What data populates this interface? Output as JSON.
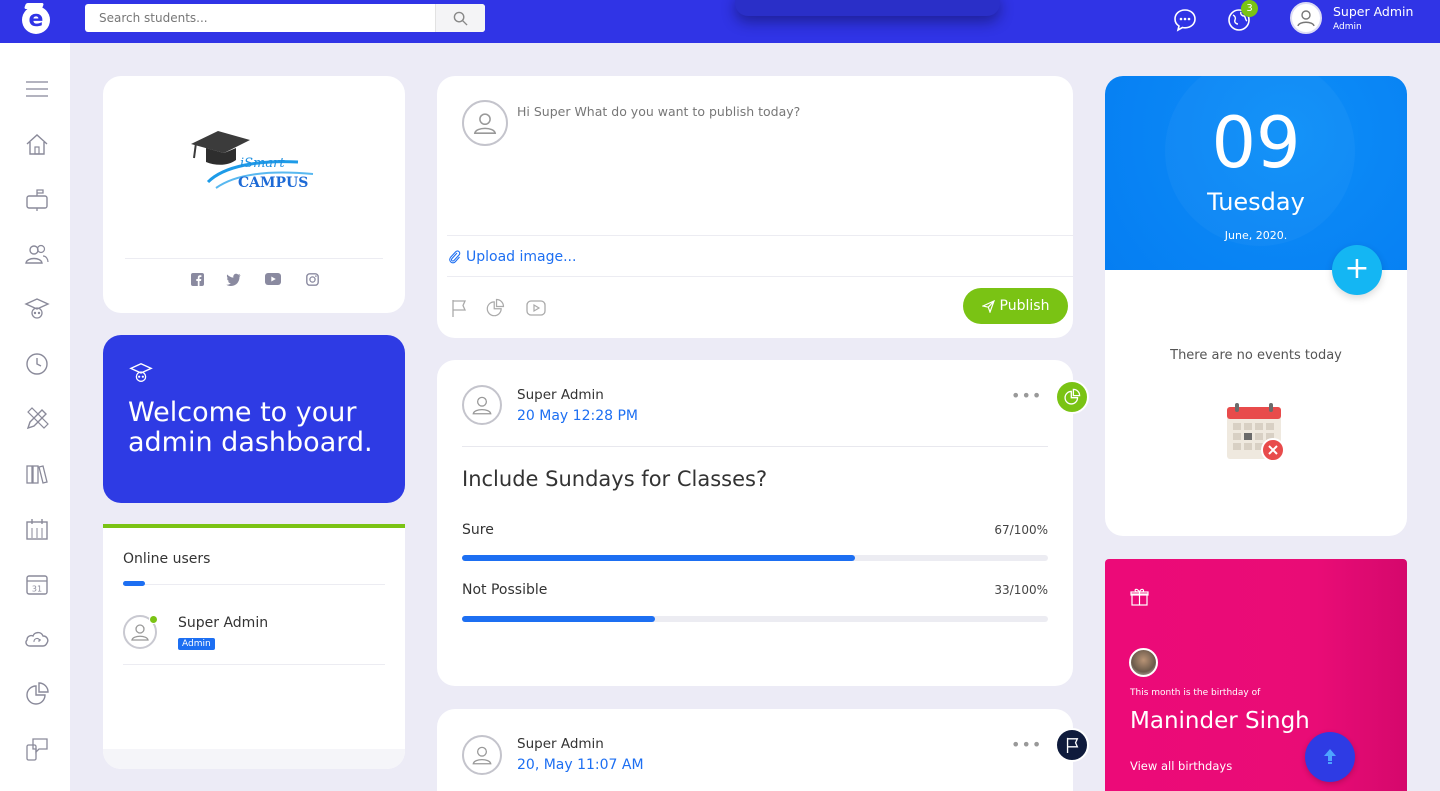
{
  "topbar": {
    "logo_letter": "e",
    "search_placeholder": "Search students...",
    "notification_count": "3",
    "user_name": "Super Admin",
    "user_role": "Admin"
  },
  "sidebar": {
    "items": [
      "menu",
      "home",
      "mailbox",
      "users",
      "graduation",
      "clock",
      "pencil-ruler",
      "books",
      "calendar-grid",
      "calendar-31",
      "cloud-sync",
      "chart-pie",
      "chat-phone"
    ]
  },
  "profile": {
    "brand_line1": "iSmart",
    "brand_line2": "CAMPUS",
    "social": [
      "facebook",
      "twitter",
      "youtube",
      "instagram"
    ]
  },
  "welcome": {
    "title": "Welcome to your admin dashboard."
  },
  "online_users": {
    "title": "Online users",
    "users": [
      {
        "name": "Super Admin",
        "role": "Admin"
      }
    ]
  },
  "composer": {
    "prompt": "Hi Super What do you want to publish today?",
    "upload_label": "Upload image...",
    "publish_label": "Publish"
  },
  "poll": {
    "author": "Super Admin",
    "date": "20 May 12:28 PM",
    "menu": "•••",
    "question": "Include Sundays for Classes?",
    "options": [
      {
        "label": "Sure",
        "result": "67/100%",
        "fraction": 0.67
      },
      {
        "label": "Not Possible",
        "result": "33/100%",
        "fraction": 0.33
      }
    ]
  },
  "post2": {
    "author": "Super Admin",
    "date": "20, May 11:07 AM",
    "menu": "•••"
  },
  "calendar": {
    "day": "09",
    "weekday": "Tuesday",
    "month_year": "June, 2020.",
    "add_label": "+",
    "no_events": "There are no events today"
  },
  "birthday": {
    "subtitle": "This month is the birthday of",
    "name": "Maninder Singh",
    "link": "View all birthdays"
  },
  "colors": {
    "primary": "#3034e6",
    "accent_blue": "#1d6ff2",
    "green": "#7ac314",
    "pink": "#ec0a78",
    "sky": "#0a86f5"
  }
}
